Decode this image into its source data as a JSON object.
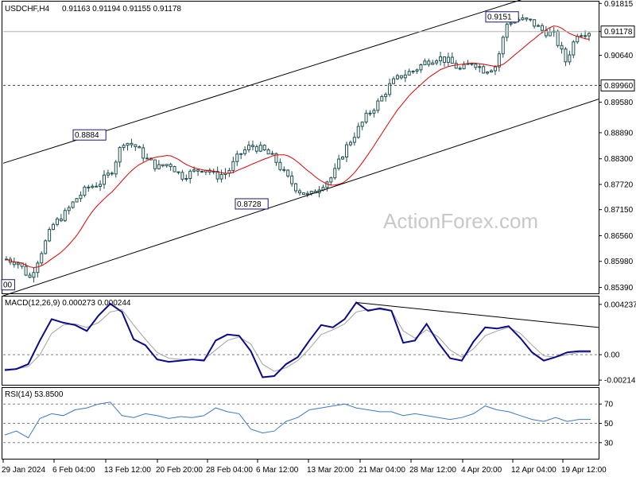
{
  "header": {
    "symbol_tf": "USDCHF,H4",
    "ohlc": "0.91163 0.91194 0.91155 0.91178"
  },
  "watermark": "ActionForex.com",
  "colors": {
    "candle": "#1e5050",
    "ma": "#e00000",
    "channel": "#000000",
    "macd": "#0a0a8c",
    "macd_signal": "#a0a0a0",
    "rsi": "#3c78c8",
    "grid_dash": "#808080",
    "label_box": "#1a1a6e"
  },
  "chart_data": [
    {
      "type": "candlestick",
      "title": "USDCHF,H4",
      "y_ticks": [
        "0.91815",
        "0.91178",
        "0.90640",
        "0.89960",
        "0.89580",
        "0.88890",
        "0.88300",
        "0.87720",
        "0.87150",
        "0.86560",
        "0.85980",
        "0.85390"
      ],
      "ylim": [
        0.8531,
        0.9182
      ],
      "x_ticks": [
        "29 Jan 2024",
        "6 Feb 04:00",
        "13 Feb 12:00",
        "20 Feb 20:00",
        "28 Feb 04:00",
        "6 Mar 12:00",
        "13 Mar 20:00",
        "21 Mar 04:00",
        "28 Mar 12:00",
        "4 Apr 20:00",
        "12 Apr 04:00",
        "19 Apr 12:00"
      ],
      "last_price": "0.91178",
      "level_price": "0.89960",
      "annotations": [
        {
          "text": "0.8884",
          "price": 0.8884
        },
        {
          "text": "0.8728",
          "price": 0.8728
        },
        {
          "text": "0.9151",
          "price": 0.9151
        },
        {
          "text": "00",
          "price": 0.8545
        }
      ],
      "close_path": [
        0.8603,
        0.8596,
        0.856,
        0.862,
        0.868,
        0.8705,
        0.874,
        0.8765,
        0.8775,
        0.88,
        0.887,
        0.886,
        0.883,
        0.881,
        0.882,
        0.879,
        0.88,
        0.881,
        0.879,
        0.88,
        0.884,
        0.886,
        0.885,
        0.883,
        0.879,
        0.876,
        0.8745,
        0.877,
        0.879,
        0.885,
        0.889,
        0.893,
        0.896,
        0.9,
        0.902,
        0.903,
        0.905,
        0.906,
        0.905,
        0.903,
        0.905,
        0.903,
        0.904,
        0.914,
        0.9145,
        0.914,
        0.912,
        0.911,
        0.905,
        0.9115,
        0.9118
      ]
    },
    {
      "type": "line",
      "title": "MACD(12,26,9) 0.000273 0.000244",
      "y_ticks": [
        "0.004237",
        "0.00",
        "-0.002142"
      ],
      "macd": [
        -0.0013,
        -0.0012,
        -0.0008,
        0.0012,
        0.003,
        0.0027,
        0.0025,
        0.002,
        0.0033,
        0.0043,
        0.0036,
        0.0013,
        0.0008,
        -0.0004,
        -0.0006,
        -0.0005,
        -0.0004,
        -0.0005,
        0.0012,
        0.0017,
        0.0016,
        0.0003,
        -0.0019,
        -0.0018,
        -0.0008,
        -0.0002,
        0.0012,
        0.0025,
        0.0023,
        0.003,
        0.0044,
        0.0037,
        0.0039,
        0.0037,
        0.001,
        0.0012,
        0.0026,
        0.001,
        -0.0003,
        -0.0005,
        0.0011,
        0.0023,
        0.0022,
        0.0024,
        0.0014,
        0.0002,
        -0.0005,
        -0.0002,
        0.0002,
        0.0003,
        0.0003
      ],
      "signal": [
        -0.0012,
        -0.0012,
        -0.001,
        0.0,
        0.0018,
        0.0025,
        0.0026,
        0.0023,
        0.0027,
        0.0036,
        0.0038,
        0.0025,
        0.0013,
        0.0002,
        -0.0003,
        -0.0004,
        -0.0004,
        -0.0004,
        0.0004,
        0.0012,
        0.0015,
        0.0009,
        -0.0008,
        -0.0014,
        -0.0011,
        -0.0005,
        0.0005,
        0.0017,
        0.0021,
        0.0026,
        0.0036,
        0.0038,
        0.0038,
        0.0037,
        0.002,
        0.0014,
        0.0021,
        0.0015,
        0.0004,
        -0.0002,
        0.0005,
        0.0016,
        0.002,
        0.0023,
        0.0018,
        0.0008,
        -0.0001,
        -0.0002,
        0.0,
        0.0002,
        0.0002
      ]
    },
    {
      "type": "line",
      "title": "RSI(14) 53.8500",
      "y_ticks": [
        "70",
        "50",
        "30"
      ],
      "ylim": [
        0,
        100
      ],
      "rsi": [
        38,
        42,
        35,
        55,
        60,
        58,
        64,
        66,
        70,
        72,
        58,
        56,
        60,
        58,
        55,
        57,
        56,
        58,
        66,
        62,
        60,
        44,
        40,
        42,
        52,
        56,
        64,
        66,
        68,
        70,
        66,
        64,
        62,
        62,
        58,
        60,
        58,
        56,
        54,
        56,
        60,
        68,
        64,
        62,
        58,
        54,
        52,
        56,
        52,
        54,
        54
      ]
    }
  ]
}
